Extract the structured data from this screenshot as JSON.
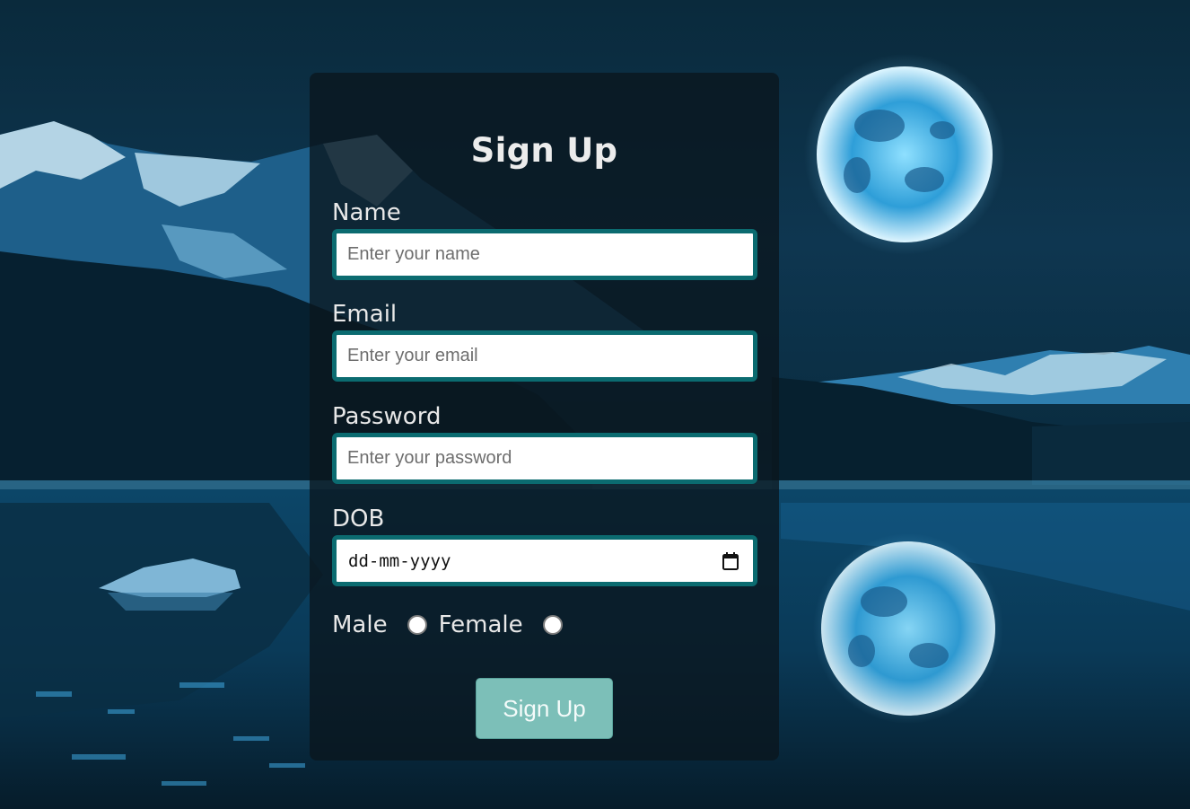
{
  "form": {
    "title": "Sign Up",
    "fields": {
      "name": {
        "label": "Name",
        "placeholder": "Enter your name",
        "value": ""
      },
      "email": {
        "label": "Email",
        "placeholder": "Enter your email",
        "value": ""
      },
      "password": {
        "label": "Password",
        "placeholder": "Enter your password",
        "value": ""
      },
      "dob": {
        "label": "DOB",
        "placeholder": "dd-mm-yyyy",
        "icon": "calendar-icon"
      }
    },
    "gender": {
      "options": [
        {
          "label": "Male",
          "checked": false
        },
        {
          "label": "Female",
          "checked": false
        }
      ]
    },
    "submit_label": "Sign Up"
  },
  "colors": {
    "input_border": "#0b6b70",
    "button_bg": "#7cbfb8",
    "card_bg": "#0a161e"
  }
}
